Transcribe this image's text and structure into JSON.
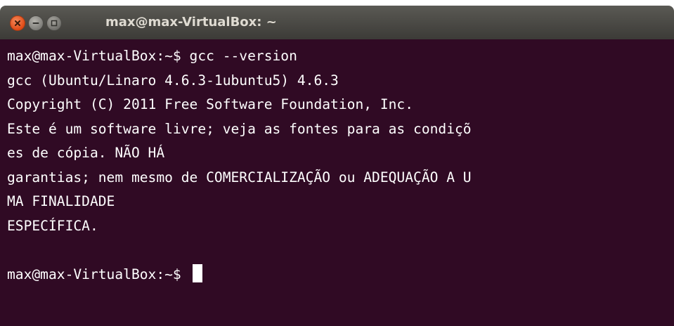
{
  "window": {
    "title": "max@max-VirtualBox: ~"
  },
  "terminal": {
    "lines": [
      "max@max-VirtualBox:~$ gcc --version",
      "gcc (Ubuntu/Linaro 4.6.3-1ubuntu5) 4.6.3",
      "Copyright (C) 2011 Free Software Foundation, Inc.",
      "Este é um software livre; veja as fontes para as condiçõ",
      "es de cópia. NÃO HÁ",
      "garantias; nem mesmo de COMERCIALIZAÇÃO ou ADEQUAÇÃO A U",
      "MA FINALIDADE",
      "ESPECÍFICA.",
      ""
    ],
    "prompt": "max@max-VirtualBox:~$ "
  },
  "colors": {
    "terminal_bg": "#300a24",
    "terminal_fg": "#ffffff",
    "titlebar": "#3c3b37",
    "close_button": "#df4a16"
  },
  "icons": [
    "close-icon",
    "minimize-icon",
    "maximize-icon"
  ]
}
